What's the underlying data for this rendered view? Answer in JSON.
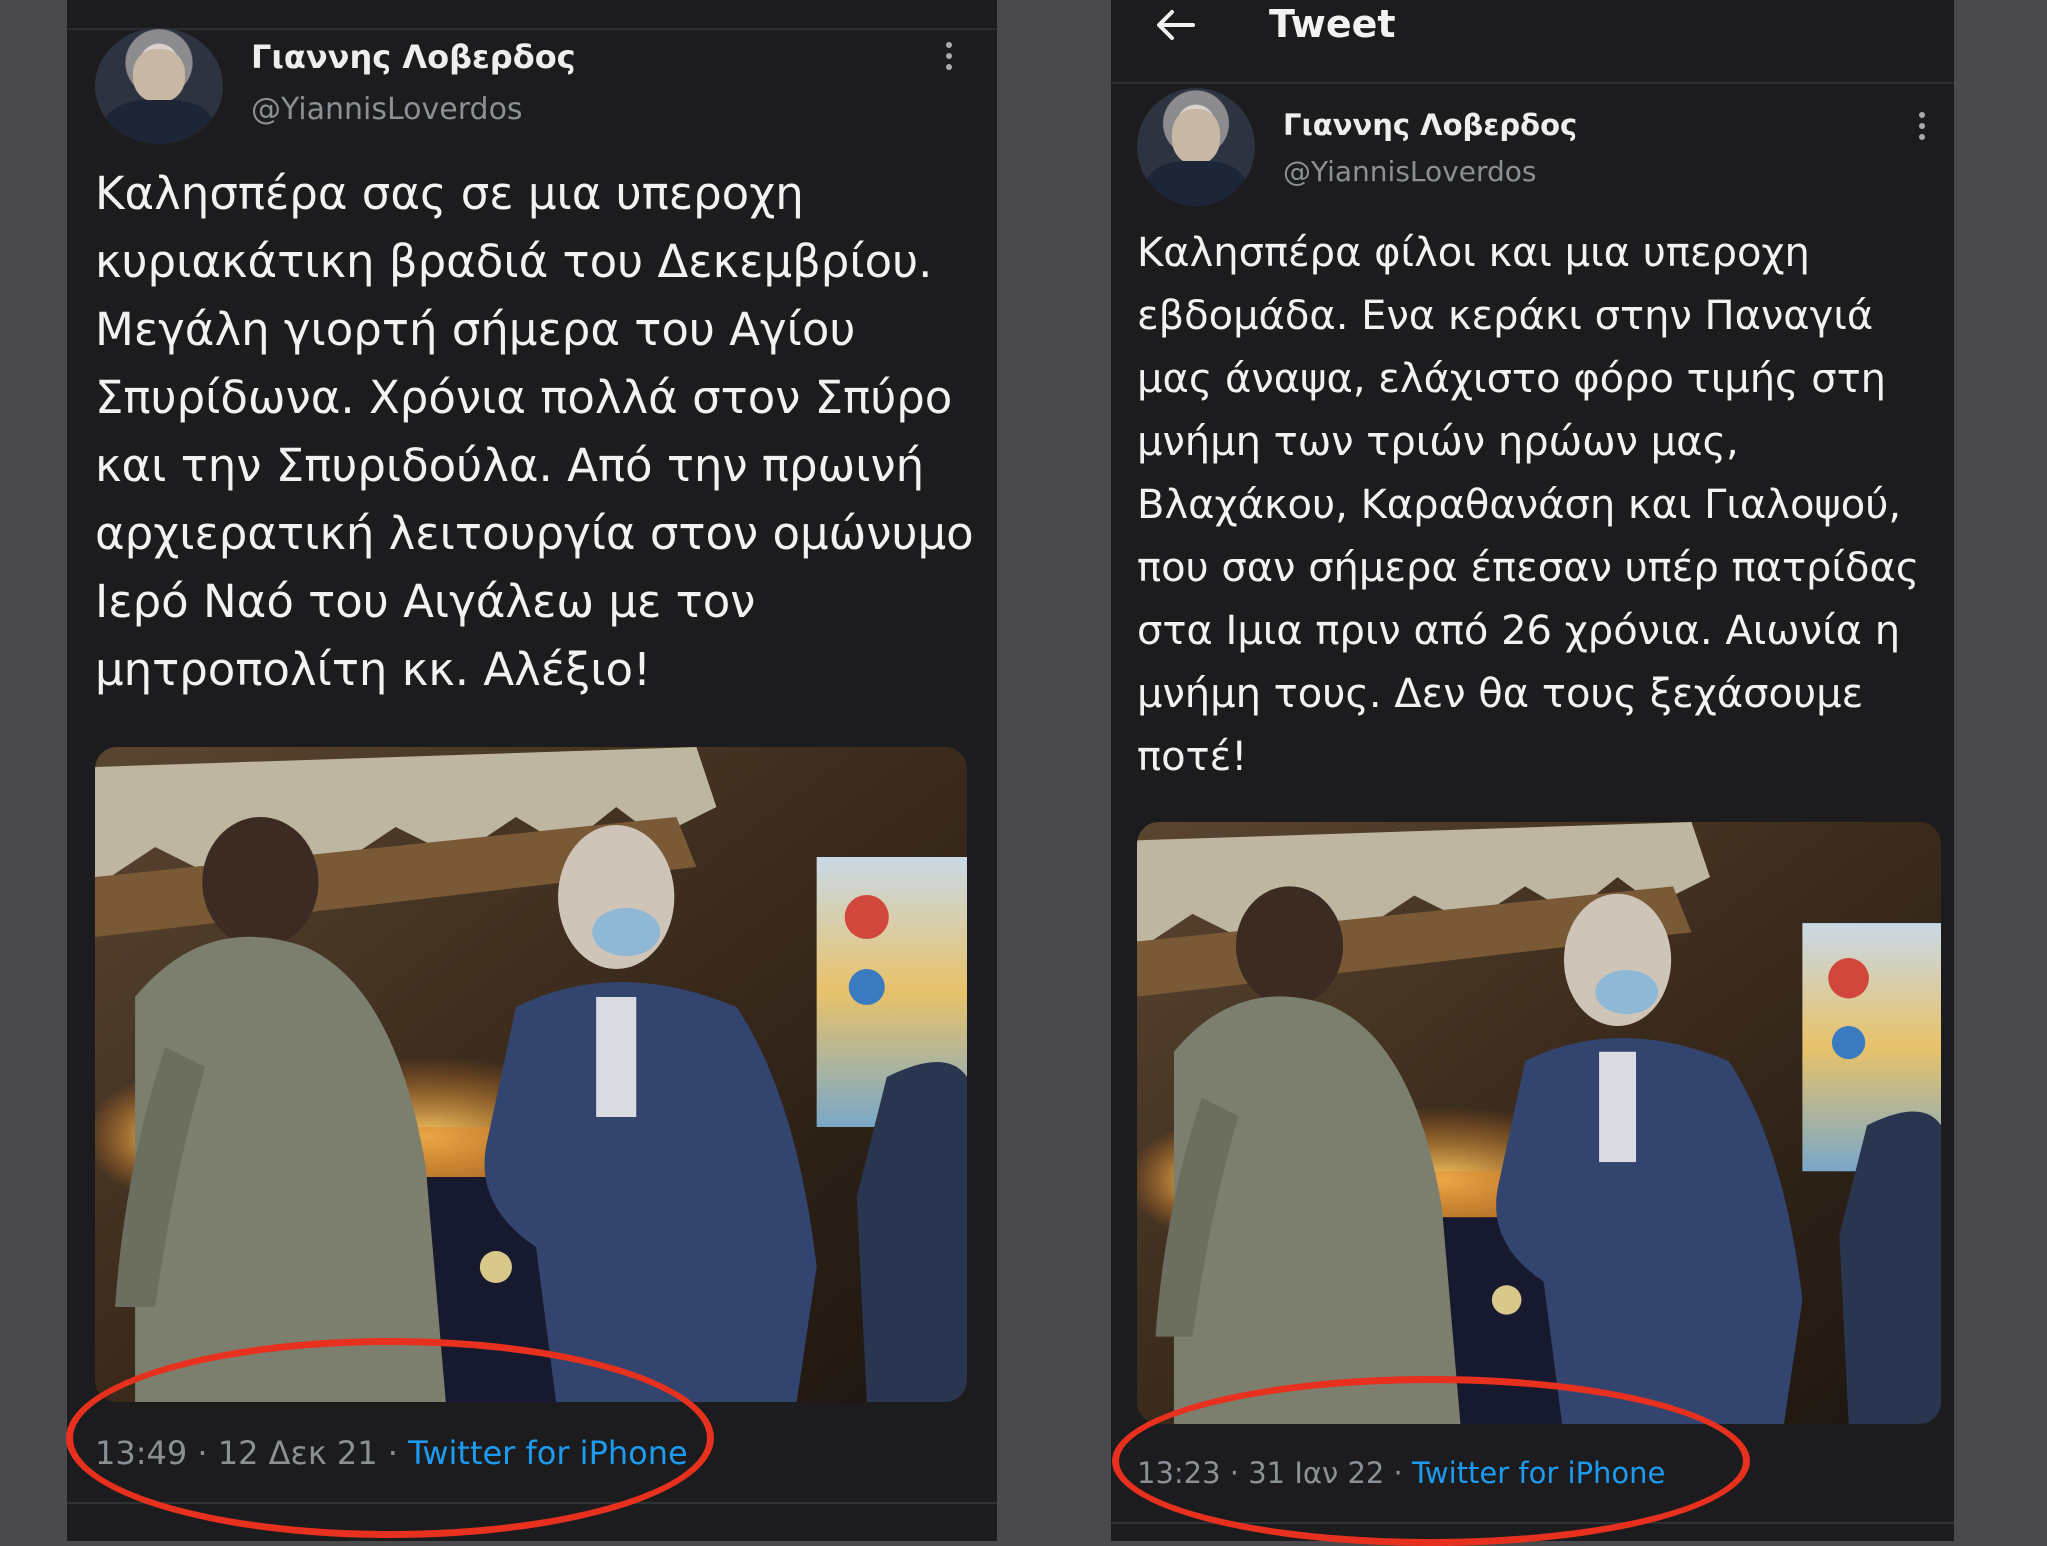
{
  "left_tweet": {
    "display_name": "Γιαννης Λοβερδος",
    "handle": "@YiannisLoverdos",
    "text": "Καλησπέρα σας σε μια υπεροχη κυριακάτικη βραδιά του Δεκεμβρίου. Μεγάλη γιορτή σήμερα του Αγίου Σπυρίδωνα. Χρόνια πολλά στον Σπύρο και την Σπυριδούλα. Από την πρωινή αρχιερατική λειτουργία στον ομώνυμο Ιερό Ναό του Αιγάλεω με τον μητροπολίτη κκ. Αλέξιο!",
    "time": "13:49",
    "date": "12 Δεκ 21",
    "source": "Twitter for iPhone"
  },
  "right_tweet": {
    "header_title": "Tweet",
    "display_name": "Γιαννης Λοβερδος",
    "handle": "@YiannisLoverdos",
    "text": "Καλησπέρα φίλοι και μια υπεροχη εβδομάδα. Ενα κεράκι στην Παναγιά μας άναψα, ελάχιστο φόρο τιμής στη μνήμη των τριών ηρώων μας, Βλαχάκου, Καραθανάση και Γιαλοψού, που σαν σήμερα έπεσαν υπέρ πατρίδας στα Ιμια πριν από 26 χρόνια. Αιωνία η μνήμη τους. Δεν θα τους ξεχάσουμε ποτέ!",
    "time": "13:23",
    "date": "31 Ιαν 22",
    "source": "Twitter for iPhone"
  },
  "separator": " · ",
  "colors": {
    "background": "#1c1c1e",
    "link": "#1d9bf0",
    "secondary_text": "#8b9096",
    "highlight_ring": "#e8301f"
  },
  "icons": {
    "more": "vertical-ellipsis-icon",
    "back": "arrow-left-icon"
  }
}
